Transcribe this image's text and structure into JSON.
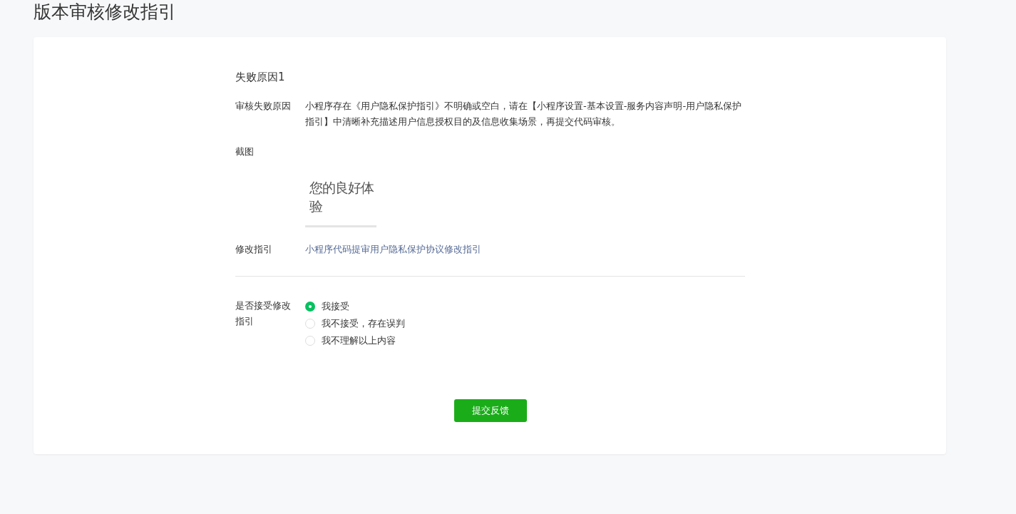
{
  "page_title": "版本审核修改指引",
  "section_title": "失败原因1",
  "reason": {
    "label": "审核失败原因",
    "text": "小程序存在《用户隐私保护指引》不明确或空白，请在【小程序设置-基本设置-服务内容声明-用户隐私保护指引】中清晰补充描述用户信息授权目的及信息收集场景，再提交代码审核。"
  },
  "screenshot": {
    "label": "截图",
    "image_text": "您的良好体验"
  },
  "guide": {
    "label": "修改指引",
    "link": "小程序代码提审用户隐私保护协议修改指引"
  },
  "accept": {
    "label": "是否接受修改指引",
    "options": [
      {
        "label": "我接受",
        "selected": true
      },
      {
        "label": "我不接受，存在误判",
        "selected": false
      },
      {
        "label": "我不理解以上内容",
        "selected": false
      }
    ]
  },
  "submit_button": "提交反馈"
}
